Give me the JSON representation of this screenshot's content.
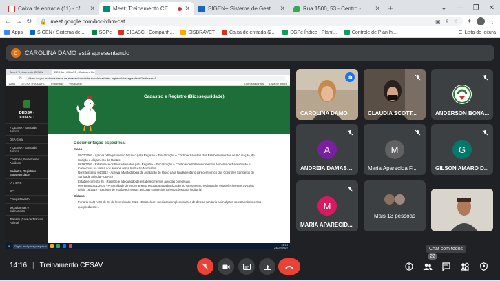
{
  "browser": {
    "tabs": [
      {
        "title": "Caixa de entrada (11) - cfcordei...",
        "icon": "gmail-icon",
        "color": "#d93025",
        "active": false
      },
      {
        "title": "Meet: Treinamento CESAV",
        "icon": "meet-icon",
        "color": "#00897b",
        "active": true
      },
      {
        "title": "SIGEN+ Sistema de Gestão da D...",
        "icon": "sigen-icon",
        "color": "#1565c0",
        "active": false
      },
      {
        "title": "Rua 1500, 53 - Centro - Google ...",
        "icon": "maps-icon",
        "color": "#34a853",
        "active": false
      }
    ],
    "url": "meet.google.com/bor-ixhm-cat",
    "bookmarks": [
      "Apps",
      "SIGEN+ Sistema de...",
      "SGPe",
      "CIDASC - Companh...",
      "SISBRAVET",
      "Caixa de entrada (2...",
      "SGPe Índice - Planil...",
      "Controle de Planilh..."
    ],
    "reading_list": "Lista de leitura"
  },
  "meet": {
    "presenter_initial": "C",
    "presenting_text": "CAROLINA DAMO está apresentando",
    "time": "14:16",
    "meeting_name": "Treinamento CESAV",
    "participant_count": "22",
    "chat_tooltip": "Chat com todos",
    "participants": [
      {
        "name": "CAROLINA DAMO",
        "type": "video",
        "speaking": true
      },
      {
        "name": "CLAUDIA SCOTT...",
        "type": "video",
        "speaking": false
      },
      {
        "name": "ANDERSON BONA...",
        "type": "logo",
        "speaking": false
      },
      {
        "name": "ANDREIA DAMASC...",
        "initial": "A",
        "color": "#7b1fa2"
      },
      {
        "name": "Maria Aparecida F...",
        "initial": "M",
        "color": "#616161"
      },
      {
        "name": "GILSON AMARO D...",
        "initial": "G",
        "color": "#00796b"
      },
      {
        "name": "MARIA APARECID...",
        "initial": "M",
        "color": "#d81b60"
      },
      {
        "name": "Mais 13 pessoas",
        "type": "more"
      },
      {
        "name": "",
        "type": "self-video"
      }
    ]
  },
  "shared": {
    "tabs": [
      "Meet: Treinamento CESAV",
      "DEDSA - CIDASC - Cadastro Re..."
    ],
    "url": "cidasc.sc.gov.br/dedsa/areas-de-atuacao/sanidade-avicola/cadastro-registro-biosseguridade/?authuser=0",
    "bookmarks": [
      "Apps",
      "DEDSA TRABALHO",
      "Importado",
      "WhatsApp",
      "Outros favoritos",
      "Lista de leitura"
    ],
    "sidebar": {
      "brand_line1": "DEDSA -",
      "brand_line2": "CIDASC",
      "items": [
        "» CESMA - Sanidade Avícola",
        "DSA Geral",
        "» CESMA - Sanidade Avícola",
        "Controles, Relatórios e Análises",
        "Cadastro, Registro e Biosseguridade",
        "IA e DNC",
        "CP",
        "Compartimento",
        "Micoplasmas e Salmonelas",
        "Trânsito (Guia de Trânsito Animal)"
      ]
    },
    "heading": "Cadastro e Registro (Biosseguridade)",
    "section": "Documentação específica:",
    "sub1": "Mapa",
    "items1": [
      "IN 02/2007 - Aprova o Regulamento Técnico para Registro – Fiscalização e Controle Sanitário dos Estabelecimentos de Incubação, de Criação e Alojamento de Ratitas",
      "IN 56/2007 - Estabelece os Procedimentos para Registro – Fiscalização – Controle de Estabelecimentos Avícolas de Reprodução e Comerciais na forma dos anexos desta Instrução Normativa",
      "Norma interna 04/2012 - Aprova a Metodologia de Avaliação de Risco para fundamentar o parecer técnico dos Controles Sanitários de Sanidade Avícola - CEASV",
      "Estabelecimento 25 - Registro e adequação de estabelecimentos avícolas comerciais",
      "Memorando 01/2019 - Proximidade de encerramento prazo para padronização do saneamento registro dos estabelecimentos avícolas",
      "Ofício 16/2019 - Registro de estabelecimentos avícolas comerciais (orientações para indústria)"
    ],
    "sub2": "Cidasc",
    "items2": [
      "Portaria SAR n°09 de 04 de fevereiro de 2022 - Estabelecer medidas complementares de defesa sanitária animal para os estabelecimentos que produzem..."
    ],
    "taskbar": {
      "search": "Digite aqui para pesquisar",
      "time": "14:16",
      "date": "24/02/2022"
    }
  },
  "taskbar": {
    "search_placeholder": "Digite aqui para pesquisar",
    "lang": "POR",
    "layout": "PTB2",
    "time": "14:16",
    "date": "24/02/2022",
    "notifications": "4"
  }
}
